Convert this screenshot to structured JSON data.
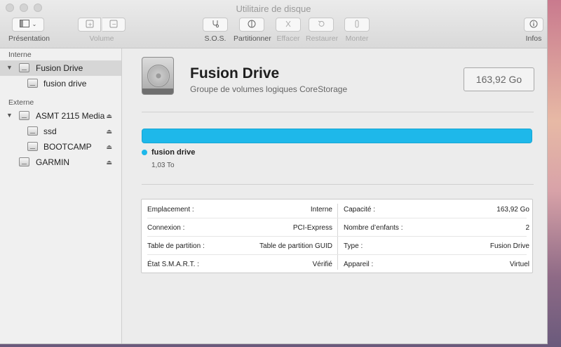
{
  "window": {
    "title": "Utilitaire de disque"
  },
  "toolbar": {
    "presentation": "Présentation",
    "volume": "Volume",
    "sos": "S.O.S.",
    "partition": "Partitionner",
    "erase": "Effacer",
    "restore": "Restaurer",
    "mount": "Monter",
    "info": "Infos"
  },
  "sidebar": {
    "internal_header": "Interne",
    "external_header": "Externe",
    "items": [
      {
        "label": "Fusion Drive",
        "selected": true
      },
      {
        "label": "fusion drive"
      },
      {
        "label": "ASMT 2115 Media"
      },
      {
        "label": "ssd"
      },
      {
        "label": "BOOTCAMP"
      },
      {
        "label": "GARMIN"
      }
    ]
  },
  "volume": {
    "name": "Fusion Drive",
    "subtitle": "Groupe de volumes logiques CoreStorage",
    "size": "163,92 Go",
    "usage_color": "#1eb8ea",
    "legend_name": "fusion drive",
    "legend_size": "1,03 To"
  },
  "info": {
    "rows": [
      {
        "k1": "Emplacement :",
        "v1": "Interne",
        "k2": "Capacité :",
        "v2": "163,92 Go"
      },
      {
        "k1": "Connexion :",
        "v1": "PCI-Express",
        "k2": "Nombre d’enfants :",
        "v2": "2"
      },
      {
        "k1": "Table de partition :",
        "v1": "Table de partition GUID",
        "k2": "Type :",
        "v2": "Fusion Drive"
      },
      {
        "k1": "État S.M.A.R.T. :",
        "v1": "Vérifié",
        "k2": "Appareil :",
        "v2": "Virtuel"
      }
    ]
  }
}
